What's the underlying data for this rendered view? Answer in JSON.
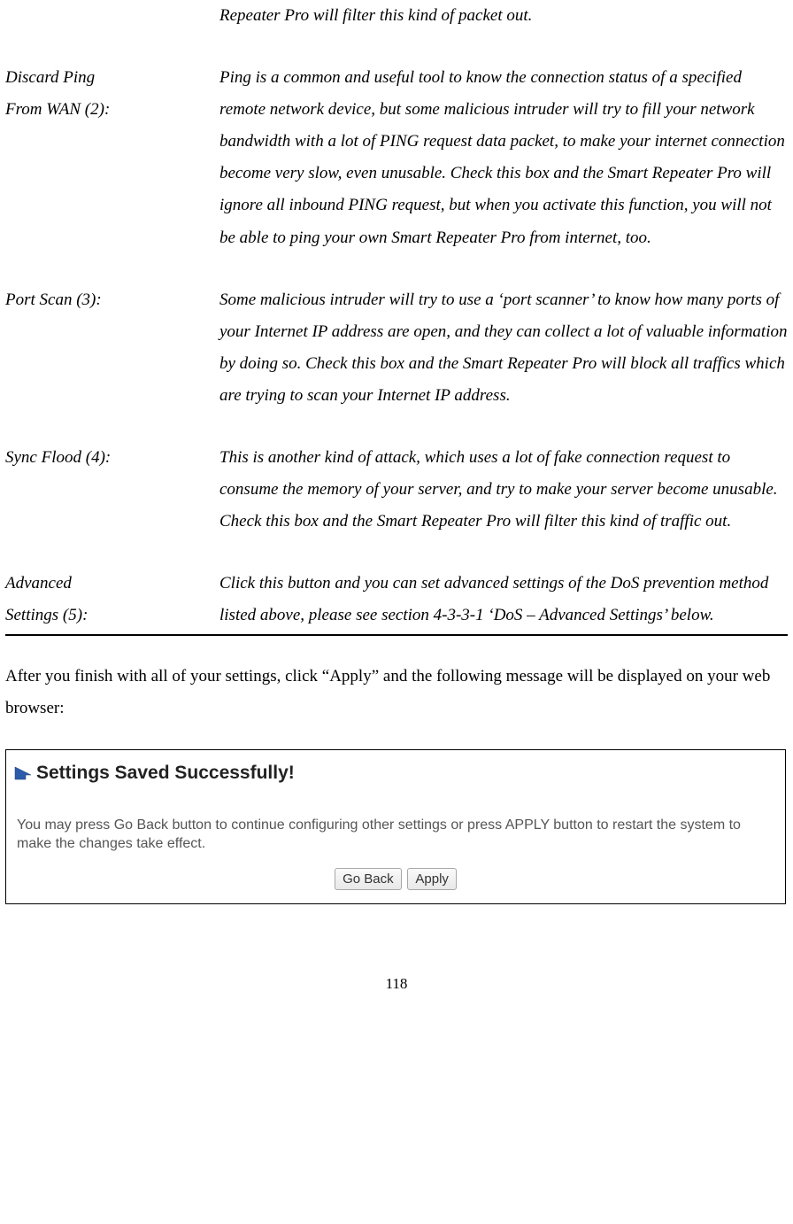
{
  "orphan_line": "Repeater Pro will filter this kind of packet out.",
  "definitions": [
    {
      "label": "Discard Ping\nFrom WAN (2):",
      "desc": "Ping is a common and useful tool to know the connection status of a specified remote network device, but some malicious intruder will try to fill your network bandwidth with a lot of PING request data packet, to make your internet connection become very slow, even unusable. Check this box and the Smart Repeater Pro will ignore all inbound PING request, but when you activate this function, you will not be able to ping your own Smart Repeater Pro from internet, too."
    },
    {
      "label": "Port Scan (3):",
      "desc": "Some malicious intruder will try to use a ‘port scanner’ to know how many ports of your Internet IP address are open, and they can collect a lot of valuable information by doing so. Check this box and the Smart Repeater Pro will block all traffics which are trying to scan your Internet IP address."
    },
    {
      "label": "Sync Flood (4):",
      "desc": "This is another kind of attack, which uses a lot of fake connection request to consume the memory of your server, and try to make your server become unusable. Check this box and the Smart Repeater Pro will filter this kind of traffic out."
    },
    {
      "label": "Advanced\nSettings (5):",
      "desc": "Click this button and you can set advanced settings of the DoS prevention method listed above, please see section 4-3-3-1 ‘DoS – Advanced Settings’ below."
    }
  ],
  "after_text": "After you finish with all of your settings, click “Apply” and the following message will be displayed on your web browser:",
  "dialog": {
    "title": "Settings Saved Successfully!",
    "body": "You may press Go Back button to continue configuring other settings or press APPLY button to restart the system to make the changes take effect.",
    "btn_goback": "Go Back",
    "btn_apply": "Apply"
  },
  "page_number": "118"
}
